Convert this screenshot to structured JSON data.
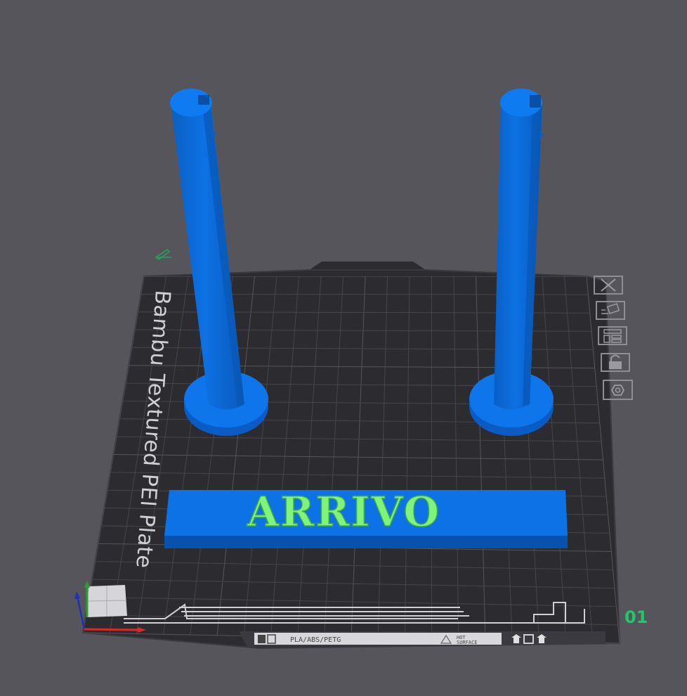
{
  "plate": {
    "name": "Bambu Textured PEI Plate",
    "index": "01",
    "filament_label": "PLA/ABS/PETG",
    "surface_label_line1": "HOT",
    "surface_label_line2": "SURFACE"
  },
  "model": {
    "text": "ARRIVO"
  },
  "colors": {
    "background": "#55555b",
    "bed": "#2c2c30",
    "grid": "#4a4a50",
    "object_blue": "#0a6ddb",
    "text_green": "#7ef47a",
    "index_green": "#1ec96b"
  },
  "plate_toolbar": [
    {
      "icon": "close-icon"
    },
    {
      "icon": "auto-orient-icon"
    },
    {
      "icon": "arrange-icon"
    },
    {
      "icon": "lock-icon"
    },
    {
      "icon": "settings-icon"
    }
  ]
}
